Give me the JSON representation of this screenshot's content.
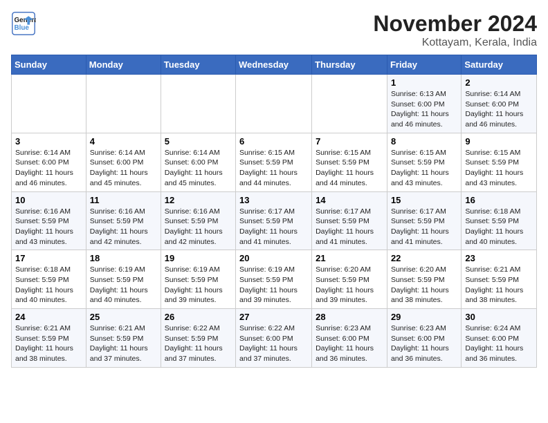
{
  "logo": {
    "line1": "General",
    "line2": "Blue"
  },
  "title": "November 2024",
  "subtitle": "Kottayam, Kerala, India",
  "weekdays": [
    "Sunday",
    "Monday",
    "Tuesday",
    "Wednesday",
    "Thursday",
    "Friday",
    "Saturday"
  ],
  "weeks": [
    [
      {
        "day": "",
        "info": ""
      },
      {
        "day": "",
        "info": ""
      },
      {
        "day": "",
        "info": ""
      },
      {
        "day": "",
        "info": ""
      },
      {
        "day": "",
        "info": ""
      },
      {
        "day": "1",
        "info": "Sunrise: 6:13 AM\nSunset: 6:00 PM\nDaylight: 11 hours and 46 minutes."
      },
      {
        "day": "2",
        "info": "Sunrise: 6:14 AM\nSunset: 6:00 PM\nDaylight: 11 hours and 46 minutes."
      }
    ],
    [
      {
        "day": "3",
        "info": "Sunrise: 6:14 AM\nSunset: 6:00 PM\nDaylight: 11 hours and 46 minutes."
      },
      {
        "day": "4",
        "info": "Sunrise: 6:14 AM\nSunset: 6:00 PM\nDaylight: 11 hours and 45 minutes."
      },
      {
        "day": "5",
        "info": "Sunrise: 6:14 AM\nSunset: 6:00 PM\nDaylight: 11 hours and 45 minutes."
      },
      {
        "day": "6",
        "info": "Sunrise: 6:15 AM\nSunset: 5:59 PM\nDaylight: 11 hours and 44 minutes."
      },
      {
        "day": "7",
        "info": "Sunrise: 6:15 AM\nSunset: 5:59 PM\nDaylight: 11 hours and 44 minutes."
      },
      {
        "day": "8",
        "info": "Sunrise: 6:15 AM\nSunset: 5:59 PM\nDaylight: 11 hours and 43 minutes."
      },
      {
        "day": "9",
        "info": "Sunrise: 6:15 AM\nSunset: 5:59 PM\nDaylight: 11 hours and 43 minutes."
      }
    ],
    [
      {
        "day": "10",
        "info": "Sunrise: 6:16 AM\nSunset: 5:59 PM\nDaylight: 11 hours and 43 minutes."
      },
      {
        "day": "11",
        "info": "Sunrise: 6:16 AM\nSunset: 5:59 PM\nDaylight: 11 hours and 42 minutes."
      },
      {
        "day": "12",
        "info": "Sunrise: 6:16 AM\nSunset: 5:59 PM\nDaylight: 11 hours and 42 minutes."
      },
      {
        "day": "13",
        "info": "Sunrise: 6:17 AM\nSunset: 5:59 PM\nDaylight: 11 hours and 41 minutes."
      },
      {
        "day": "14",
        "info": "Sunrise: 6:17 AM\nSunset: 5:59 PM\nDaylight: 11 hours and 41 minutes."
      },
      {
        "day": "15",
        "info": "Sunrise: 6:17 AM\nSunset: 5:59 PM\nDaylight: 11 hours and 41 minutes."
      },
      {
        "day": "16",
        "info": "Sunrise: 6:18 AM\nSunset: 5:59 PM\nDaylight: 11 hours and 40 minutes."
      }
    ],
    [
      {
        "day": "17",
        "info": "Sunrise: 6:18 AM\nSunset: 5:59 PM\nDaylight: 11 hours and 40 minutes."
      },
      {
        "day": "18",
        "info": "Sunrise: 6:19 AM\nSunset: 5:59 PM\nDaylight: 11 hours and 40 minutes."
      },
      {
        "day": "19",
        "info": "Sunrise: 6:19 AM\nSunset: 5:59 PM\nDaylight: 11 hours and 39 minutes."
      },
      {
        "day": "20",
        "info": "Sunrise: 6:19 AM\nSunset: 5:59 PM\nDaylight: 11 hours and 39 minutes."
      },
      {
        "day": "21",
        "info": "Sunrise: 6:20 AM\nSunset: 5:59 PM\nDaylight: 11 hours and 39 minutes."
      },
      {
        "day": "22",
        "info": "Sunrise: 6:20 AM\nSunset: 5:59 PM\nDaylight: 11 hours and 38 minutes."
      },
      {
        "day": "23",
        "info": "Sunrise: 6:21 AM\nSunset: 5:59 PM\nDaylight: 11 hours and 38 minutes."
      }
    ],
    [
      {
        "day": "24",
        "info": "Sunrise: 6:21 AM\nSunset: 5:59 PM\nDaylight: 11 hours and 38 minutes."
      },
      {
        "day": "25",
        "info": "Sunrise: 6:21 AM\nSunset: 5:59 PM\nDaylight: 11 hours and 37 minutes."
      },
      {
        "day": "26",
        "info": "Sunrise: 6:22 AM\nSunset: 5:59 PM\nDaylight: 11 hours and 37 minutes."
      },
      {
        "day": "27",
        "info": "Sunrise: 6:22 AM\nSunset: 6:00 PM\nDaylight: 11 hours and 37 minutes."
      },
      {
        "day": "28",
        "info": "Sunrise: 6:23 AM\nSunset: 6:00 PM\nDaylight: 11 hours and 36 minutes."
      },
      {
        "day": "29",
        "info": "Sunrise: 6:23 AM\nSunset: 6:00 PM\nDaylight: 11 hours and 36 minutes."
      },
      {
        "day": "30",
        "info": "Sunrise: 6:24 AM\nSunset: 6:00 PM\nDaylight: 11 hours and 36 minutes."
      }
    ]
  ]
}
